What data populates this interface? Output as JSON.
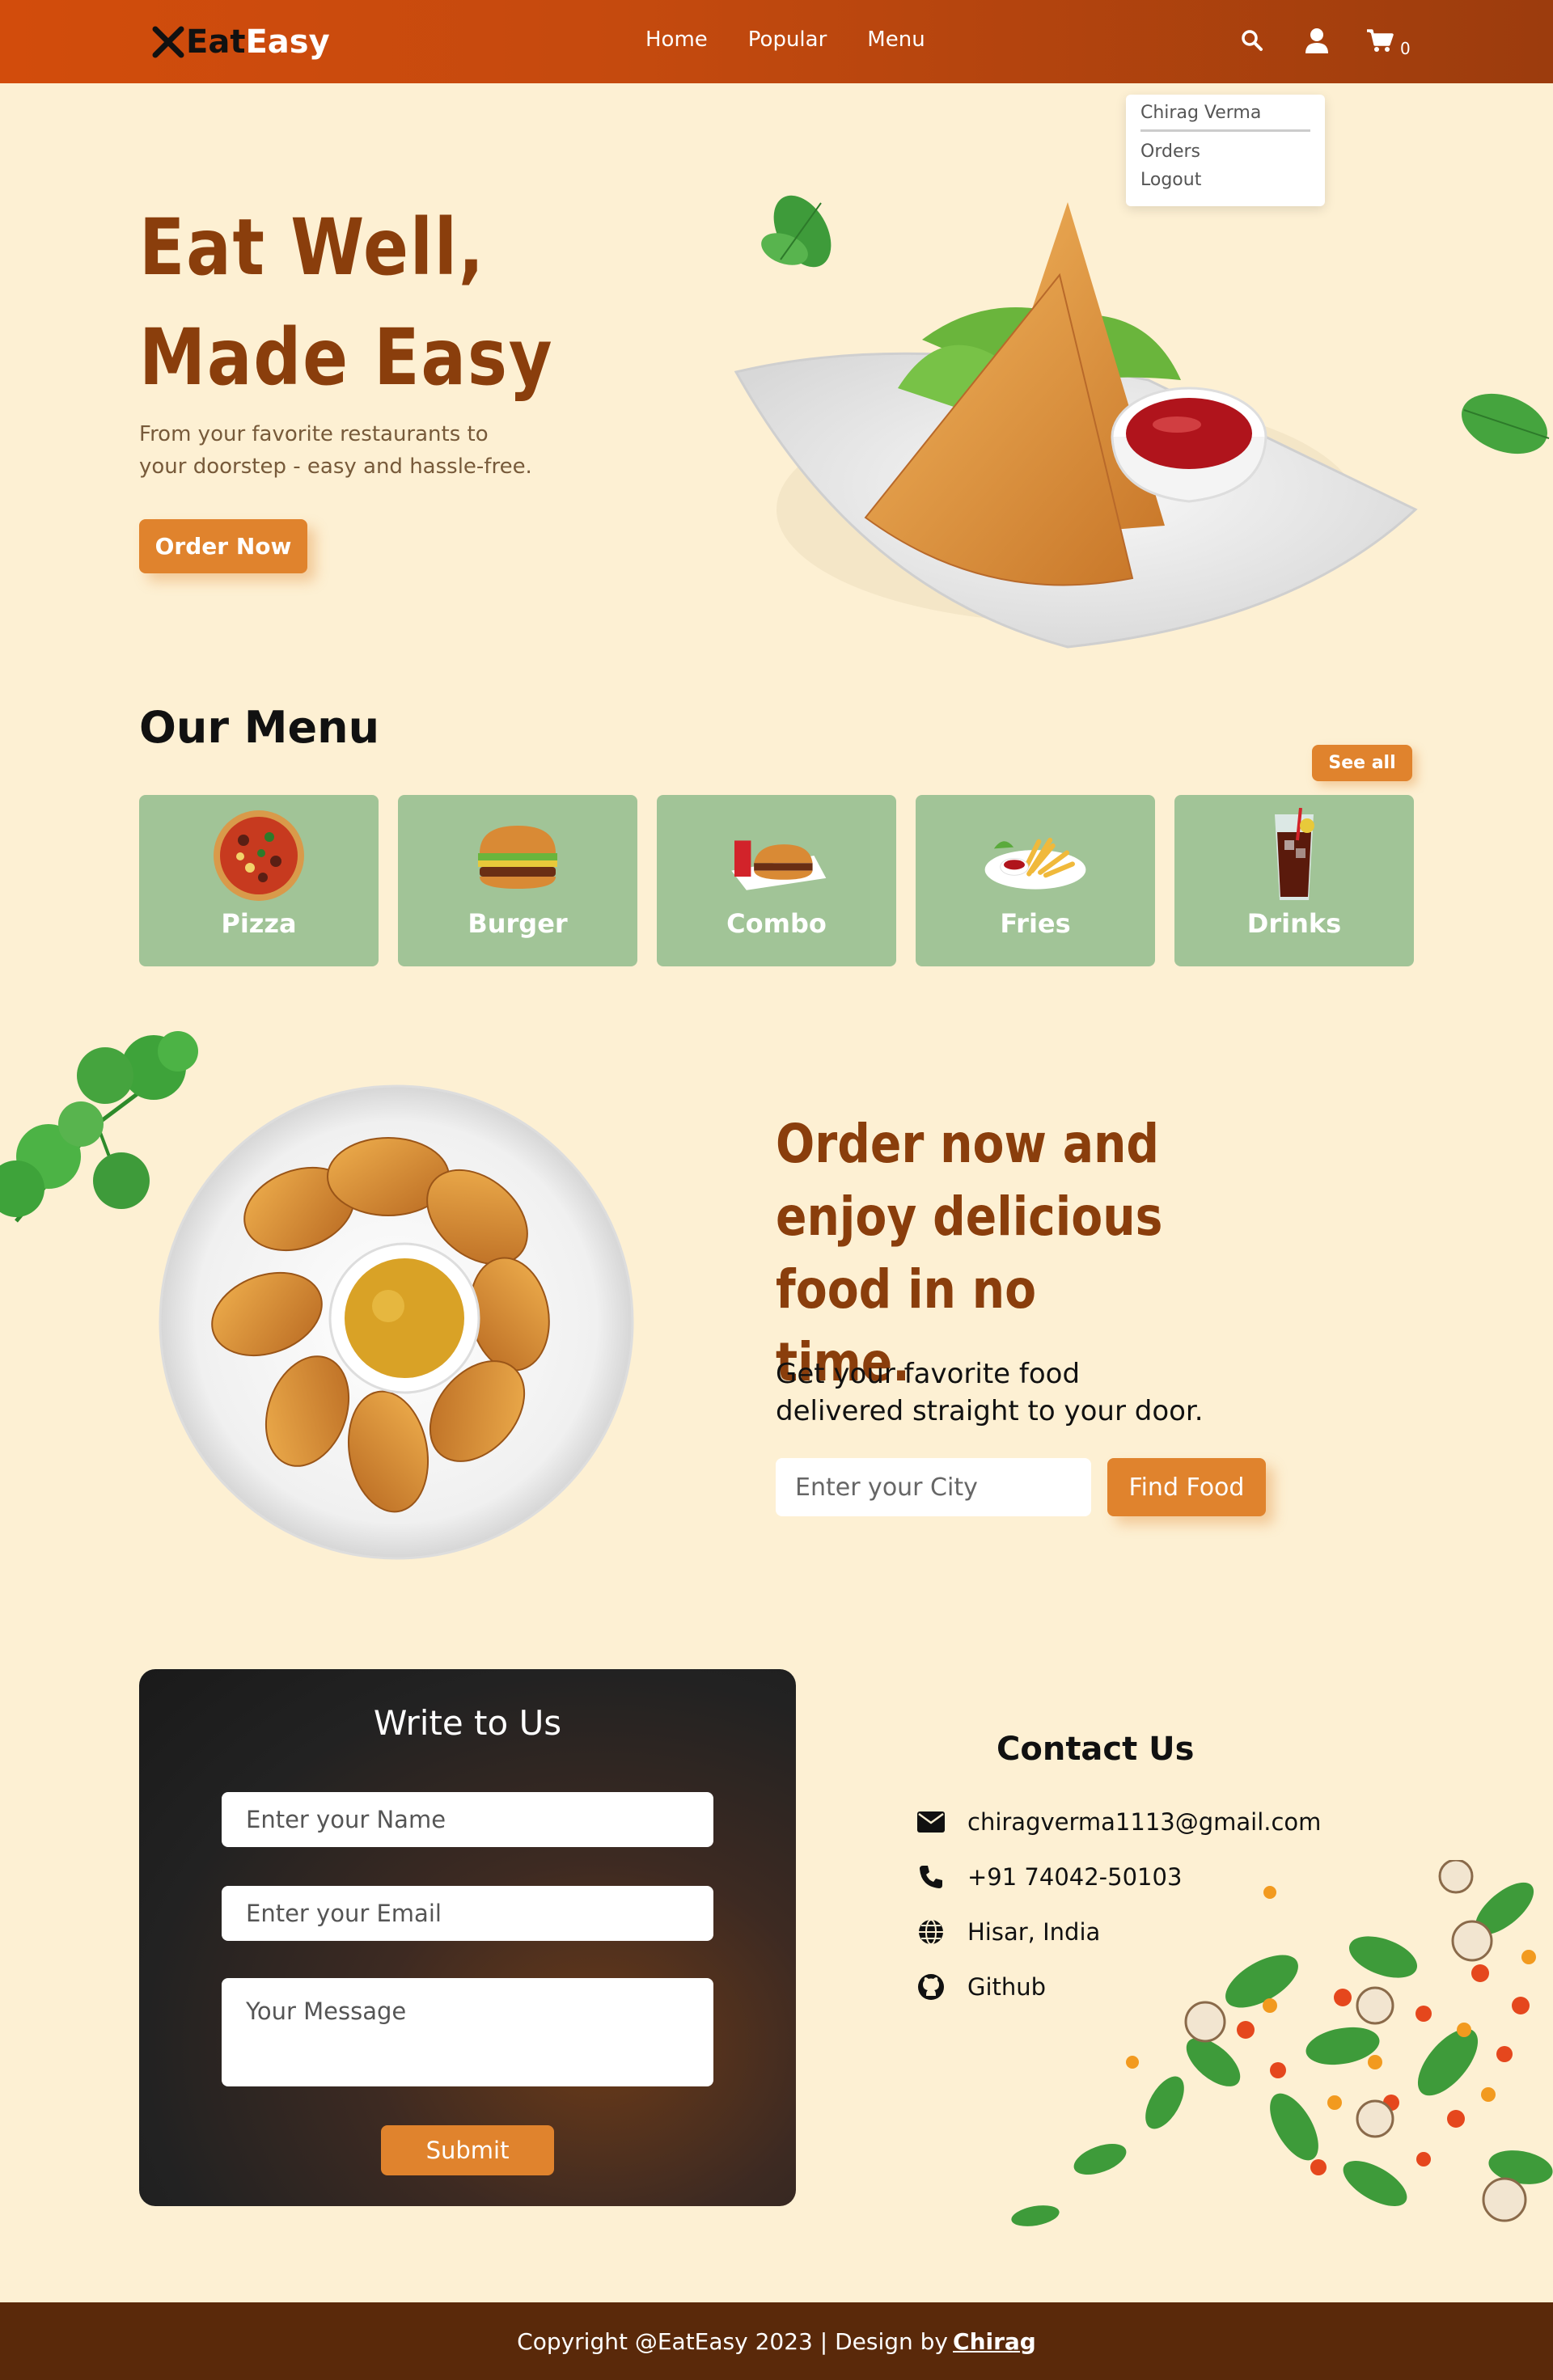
{
  "brand": {
    "prefix": "Eat",
    "suffix": "Easy"
  },
  "nav": {
    "links": [
      "Home",
      "Popular",
      "Menu"
    ],
    "cart_count": "0"
  },
  "user_menu": {
    "name": "Chirag Verma",
    "items": [
      "Orders",
      "Logout"
    ]
  },
  "hero": {
    "title_line1": "Eat Well,",
    "title_line2": "Made Easy",
    "subtitle": "From your favorite restaurants to your doorstep - easy and hassle-free.",
    "cta": "Order Now"
  },
  "menu": {
    "title": "Our Menu",
    "see_all": "See all",
    "categories": [
      {
        "label": "Pizza",
        "icon": "pizza-icon"
      },
      {
        "label": "Burger",
        "icon": "burger-icon"
      },
      {
        "label": "Combo",
        "icon": "combo-icon"
      },
      {
        "label": "Fries",
        "icon": "fries-icon"
      },
      {
        "label": "Drinks",
        "icon": "drinks-icon"
      }
    ]
  },
  "promo": {
    "title": "Order now and enjoy delicious food in no time.",
    "subtitle_line1": "Get your favorite food",
    "subtitle_line2": "delivered straight to your door.",
    "city_placeholder": "Enter your City",
    "button": "Find Food"
  },
  "write_form": {
    "title": "Write to Us",
    "name_placeholder": "Enter your Name",
    "email_placeholder": "Enter your Email",
    "message_placeholder": "Your Message",
    "submit": "Submit"
  },
  "contact": {
    "title": "Contact Us",
    "email": "chiragverma1113@gmail.com",
    "phone": "+91 74042-50103",
    "location": "Hisar, India",
    "github": "Github"
  },
  "footer": {
    "text": "Copyright @EatEasy 2023 | Design by",
    "link": "Chirag"
  },
  "colors": {
    "accent": "#e0832d",
    "heading": "#8a3e0c",
    "menu_card": "#a1c497",
    "footer": "#5a290a",
    "background": "#fdf0d3"
  }
}
